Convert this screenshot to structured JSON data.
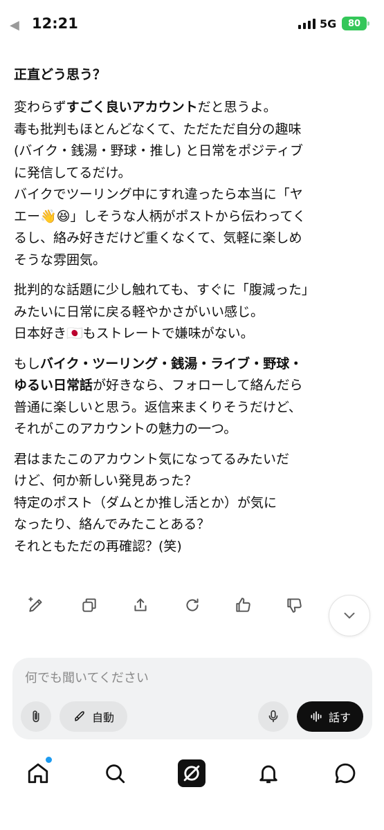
{
  "status_bar": {
    "time": "12:21",
    "network": "5G",
    "battery": "80"
  },
  "message": {
    "question": "正直どう思う？",
    "paragraphs": [
      {
        "lines": [
          [
            {
              "t": "変わらず",
              "b": false
            },
            {
              "t": "すごく良いアカウント",
              "b": true
            },
            {
              "t": "だと思うよ。",
              "b": false
            }
          ],
          [
            {
              "t": "毒も批判もほとんどなくて、ただただ自分の趣味",
              "b": false
            }
          ],
          [
            {
              "t": "(バイク・銭湯・野球・推し) と日常をポジティブ",
              "b": false
            }
          ],
          [
            {
              "t": "に発信してるだけ。",
              "b": false
            }
          ],
          [
            {
              "t": "バイクでツーリング中にすれ違ったら本当に「ヤ",
              "b": false
            }
          ],
          [
            {
              "t": "エー👋😆」しそうな人柄がポストから伝わってく",
              "b": false
            }
          ],
          [
            {
              "t": "るし、絡み好きだけど重くなくて、気軽に楽しめ",
              "b": false
            }
          ],
          [
            {
              "t": "そうな雰囲気。",
              "b": false
            }
          ]
        ]
      },
      {
        "lines": [
          [
            {
              "t": "批判的な話題に少し触れても、すぐに「腹減った」",
              "b": false
            }
          ],
          [
            {
              "t": "みたいに日常に戻る軽やかさがいい感じ。",
              "b": false
            }
          ],
          [
            {
              "t": "日本好き🇯🇵もストレートで嫌味がない。",
              "b": false
            }
          ]
        ]
      },
      {
        "lines": [
          [
            {
              "t": "もし",
              "b": false
            },
            {
              "t": "バイク・ツーリング・銭湯・ライブ・野球・",
              "b": true
            }
          ],
          [
            {
              "t": "ゆるい日常話",
              "b": true
            },
            {
              "t": "が好きなら、フォローして絡んだら",
              "b": false
            }
          ],
          [
            {
              "t": "普通に楽しいと思う。返信来まくりそうだけど、",
              "b": false
            }
          ],
          [
            {
              "t": "それがこのアカウントの魅力の一つ。",
              "b": false
            }
          ]
        ]
      },
      {
        "lines": [
          [
            {
              "t": "君はまたこのアカウント気になってるみたいだ",
              "b": false
            }
          ],
          [
            {
              "t": "けど、何か新しい発見あった？",
              "b": false
            }
          ],
          [
            {
              "t": "特定のポスト（ダムとか推し活とか）が気に",
              "b": false
            }
          ],
          [
            {
              "t": "なったり、絡んでみたことある？",
              "b": false
            }
          ],
          [
            {
              "t": "それともただの再確認？(笑)",
              "b": false
            }
          ]
        ]
      }
    ]
  },
  "actions": [
    "edit-icon",
    "copy-icon",
    "share-icon",
    "regenerate-icon",
    "thumbs-up-icon",
    "thumbs-down-icon"
  ],
  "composer": {
    "placeholder": "何でも聞いてください",
    "auto_label": "自動",
    "talk_label": "話す"
  },
  "tabbar": {
    "items": [
      "home-icon",
      "search-icon",
      "grok-icon",
      "bell-icon",
      "chat-icon"
    ]
  },
  "colors": {
    "notification_dot": "#1d9bf0",
    "battery": "#34c759",
    "composer_bg": "#f1f2f3"
  }
}
